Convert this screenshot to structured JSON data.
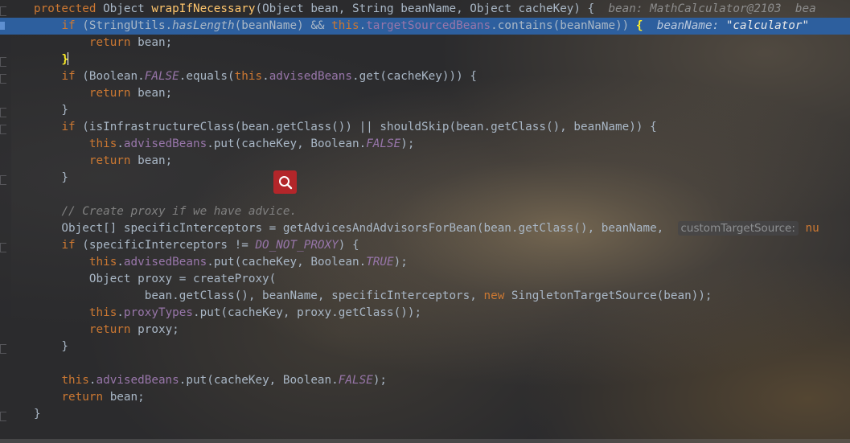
{
  "editor": {
    "lines": [
      {
        "segments": [
          {
            "c": "kw",
            "t": "protected "
          },
          {
            "c": "",
            "t": "Object "
          },
          {
            "c": "fn",
            "t": "wrapIfNecessary"
          },
          {
            "c": "",
            "t": "(Object bean, String beanName, Object cacheKey) {  "
          },
          {
            "c": "hint",
            "t": "bean: MathCalculator@2103  bea"
          }
        ]
      },
      {
        "exec": true,
        "segments": [
          {
            "c": "",
            "t": "    "
          },
          {
            "c": "kw",
            "t": "if "
          },
          {
            "c": "",
            "t": "(StringUtils."
          },
          {
            "c": "ital",
            "t": "hasLength"
          },
          {
            "c": "",
            "t": "(beanName) && "
          },
          {
            "c": "kw",
            "t": "this"
          },
          {
            "c": "",
            "t": "."
          },
          {
            "c": "fld",
            "t": "targetSourcedBeans"
          },
          {
            "c": "",
            "t": ".contains(beanName)) "
          },
          {
            "c": "brace-hl",
            "t": "{"
          },
          {
            "c": "",
            "t": "  "
          },
          {
            "c": "hint",
            "t": "beanName: "
          },
          {
            "c": "hint hintstr",
            "t": "\"calculator\""
          }
        ]
      },
      {
        "segments": [
          {
            "c": "",
            "t": "        "
          },
          {
            "c": "kw",
            "t": "return "
          },
          {
            "c": "",
            "t": "bean;"
          }
        ]
      },
      {
        "caret": true,
        "segments": [
          {
            "c": "",
            "t": "    "
          },
          {
            "c": "brace-hl",
            "t": "}"
          }
        ]
      },
      {
        "segments": [
          {
            "c": "",
            "t": "    "
          },
          {
            "c": "kw",
            "t": "if "
          },
          {
            "c": "",
            "t": "(Boolean."
          },
          {
            "c": "fld ital",
            "t": "FALSE"
          },
          {
            "c": "",
            "t": ".equals("
          },
          {
            "c": "kw",
            "t": "this"
          },
          {
            "c": "",
            "t": "."
          },
          {
            "c": "fld",
            "t": "advisedBeans"
          },
          {
            "c": "",
            "t": ".get(cacheKey))) {"
          }
        ]
      },
      {
        "segments": [
          {
            "c": "",
            "t": "        "
          },
          {
            "c": "kw",
            "t": "return "
          },
          {
            "c": "",
            "t": "bean;"
          }
        ]
      },
      {
        "segments": [
          {
            "c": "",
            "t": "    }"
          }
        ]
      },
      {
        "segments": [
          {
            "c": "",
            "t": "    "
          },
          {
            "c": "kw",
            "t": "if "
          },
          {
            "c": "",
            "t": "(isInfrastructureClass(bean.getClass()) || shouldSkip(bean.getClass(), beanName)) {"
          }
        ]
      },
      {
        "segments": [
          {
            "c": "",
            "t": "        "
          },
          {
            "c": "kw",
            "t": "this"
          },
          {
            "c": "",
            "t": "."
          },
          {
            "c": "fld",
            "t": "advisedBeans"
          },
          {
            "c": "",
            "t": ".put(cacheKey, Boolean."
          },
          {
            "c": "fld ital",
            "t": "FALSE"
          },
          {
            "c": "",
            "t": ");"
          }
        ]
      },
      {
        "segments": [
          {
            "c": "",
            "t": "        "
          },
          {
            "c": "kw",
            "t": "return "
          },
          {
            "c": "",
            "t": "bean;"
          }
        ]
      },
      {
        "segments": [
          {
            "c": "",
            "t": "    }"
          }
        ]
      },
      {
        "segments": [
          {
            "c": "",
            "t": ""
          }
        ]
      },
      {
        "segments": [
          {
            "c": "",
            "t": "    "
          },
          {
            "c": "cm",
            "t": "// Create proxy if we have advice."
          }
        ]
      },
      {
        "paramhint": "customTargetSource:",
        "paramtail": " nu",
        "segments": [
          {
            "c": "",
            "t": "    Object[] specificInterceptors = getAdvicesAndAdvisorsForBean(bean.getClass(), beanName,  "
          }
        ]
      },
      {
        "segments": [
          {
            "c": "",
            "t": "    "
          },
          {
            "c": "kw",
            "t": "if "
          },
          {
            "c": "",
            "t": "(specificInterceptors != "
          },
          {
            "c": "fld ital",
            "t": "DO_NOT_PROXY"
          },
          {
            "c": "",
            "t": ") {"
          }
        ]
      },
      {
        "segments": [
          {
            "c": "",
            "t": "        "
          },
          {
            "c": "kw",
            "t": "this"
          },
          {
            "c": "",
            "t": "."
          },
          {
            "c": "fld",
            "t": "advisedBeans"
          },
          {
            "c": "",
            "t": ".put(cacheKey, Boolean."
          },
          {
            "c": "fld ital",
            "t": "TRUE"
          },
          {
            "c": "",
            "t": ");"
          }
        ]
      },
      {
        "segments": [
          {
            "c": "",
            "t": "        Object proxy = createProxy("
          }
        ]
      },
      {
        "segments": [
          {
            "c": "",
            "t": "                bean.getClass(), beanName, specificInterceptors, "
          },
          {
            "c": "kw",
            "t": "new "
          },
          {
            "c": "",
            "t": "SingletonTargetSource(bean));"
          }
        ]
      },
      {
        "segments": [
          {
            "c": "",
            "t": "        "
          },
          {
            "c": "kw",
            "t": "this"
          },
          {
            "c": "",
            "t": "."
          },
          {
            "c": "fld",
            "t": "proxyTypes"
          },
          {
            "c": "",
            "t": ".put(cacheKey, proxy.getClass());"
          }
        ]
      },
      {
        "segments": [
          {
            "c": "",
            "t": "        "
          },
          {
            "c": "kw",
            "t": "return "
          },
          {
            "c": "",
            "t": "proxy;"
          }
        ]
      },
      {
        "segments": [
          {
            "c": "",
            "t": "    }"
          }
        ]
      },
      {
        "segments": [
          {
            "c": "",
            "t": ""
          }
        ]
      },
      {
        "segments": [
          {
            "c": "",
            "t": "    "
          },
          {
            "c": "kw",
            "t": "this"
          },
          {
            "c": "",
            "t": "."
          },
          {
            "c": "fld",
            "t": "advisedBeans"
          },
          {
            "c": "",
            "t": ".put(cacheKey, Boolean."
          },
          {
            "c": "fld ital",
            "t": "FALSE"
          },
          {
            "c": "",
            "t": ");"
          }
        ]
      },
      {
        "segments": [
          {
            "c": "",
            "t": "    "
          },
          {
            "c": "kw",
            "t": "return "
          },
          {
            "c": "",
            "t": "bean;"
          }
        ]
      },
      {
        "segments": [
          {
            "c": "",
            "t": "}"
          }
        ]
      }
    ]
  },
  "icons": {
    "search_badge": "search-icon",
    "breakpoint_marker": "execution-point-icon"
  },
  "colors": {
    "keyword": "#cc7832",
    "method_decl": "#ffc66d",
    "field": "#9876aa",
    "comment": "#808080",
    "default_text": "#a9b7c6",
    "exec_line_bg": "#2d5f9e",
    "search_badge_bg": "#b3262a"
  }
}
